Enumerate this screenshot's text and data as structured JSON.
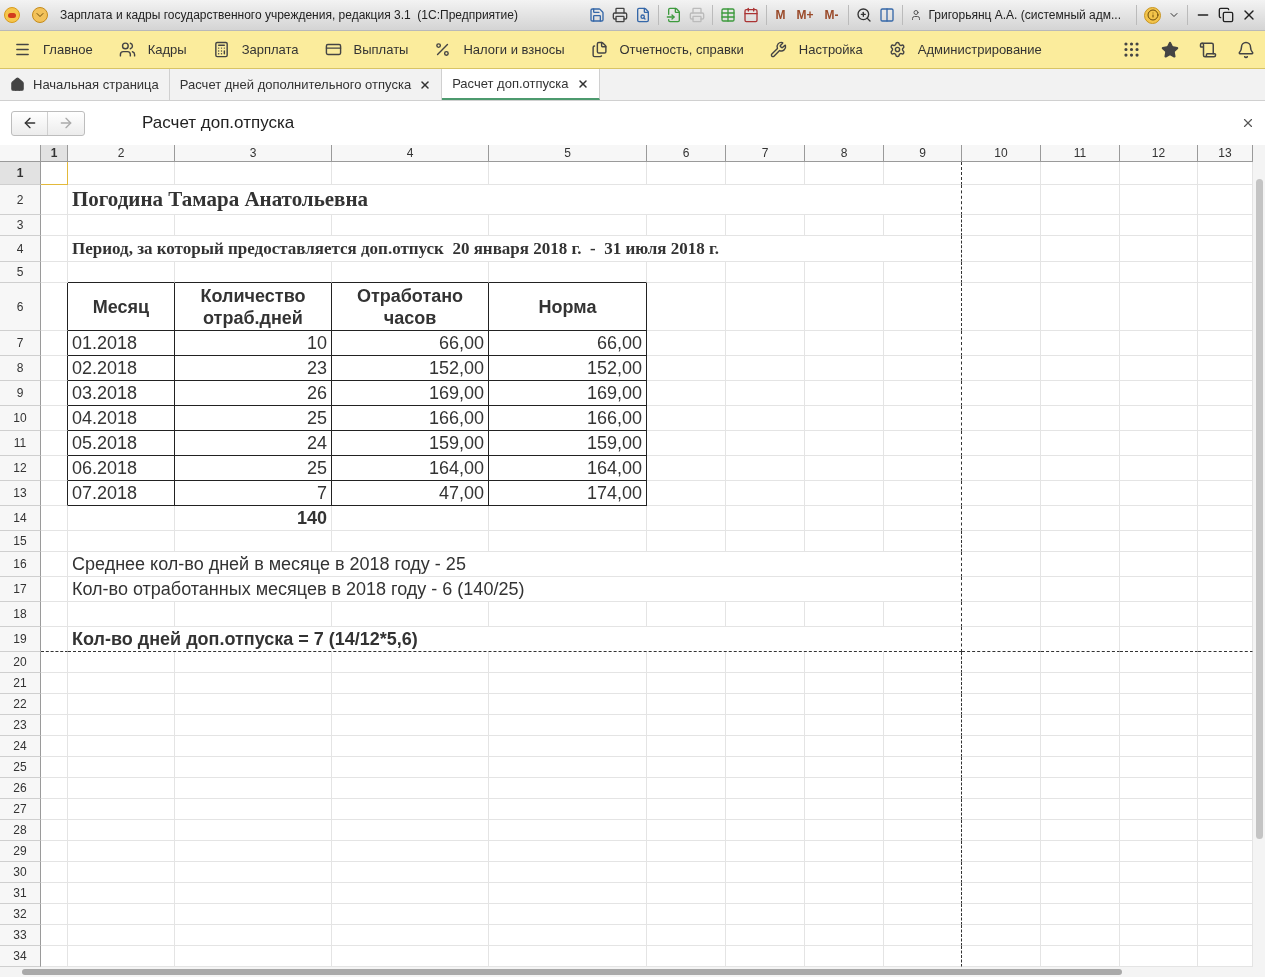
{
  "window": {
    "title": "Зарплата и кадры государственного учреждения, редакция 3.1  (1С:Предприятие)",
    "memory_buttons": [
      "M",
      "M+",
      "M-"
    ],
    "user": "Григорьянц А.А. (системный адм..."
  },
  "menu": [
    {
      "label": "Главное"
    },
    {
      "label": "Кадры"
    },
    {
      "label": "Зарплата"
    },
    {
      "label": "Выплаты"
    },
    {
      "label": "Налоги и взносы"
    },
    {
      "label": "Отчетность, справки"
    },
    {
      "label": "Настройка"
    },
    {
      "label": "Администрирование"
    }
  ],
  "tabs": [
    {
      "label": "Начальная страница",
      "selected": false,
      "kind": "home"
    },
    {
      "label": "Расчет дней дополнительного отпуска",
      "selected": false,
      "kind": "closable"
    },
    {
      "label": "Расчет доп.отпуска",
      "selected": true,
      "kind": "closable"
    }
  ],
  "form": {
    "title": "Расчет доп.отпуска"
  },
  "sheet": {
    "columns": [
      {
        "label": "1",
        "selected": true
      },
      {
        "label": "2",
        "selected": false
      },
      {
        "label": "3",
        "selected": false
      },
      {
        "label": "4",
        "selected": false
      },
      {
        "label": "5",
        "selected": false
      },
      {
        "label": "6",
        "selected": false
      },
      {
        "label": "7",
        "selected": false
      },
      {
        "label": "8",
        "selected": false
      },
      {
        "label": "9",
        "selected": false
      },
      {
        "label": "10",
        "selected": false
      },
      {
        "label": "11",
        "selected": false
      },
      {
        "label": "12",
        "selected": false
      },
      {
        "label": "13",
        "selected": false
      }
    ],
    "rows": [
      {
        "label": "1",
        "selected": true
      },
      {
        "label": "2",
        "selected": false
      },
      {
        "label": "3",
        "selected": false
      },
      {
        "label": "4",
        "selected": false
      },
      {
        "label": "5",
        "selected": false
      },
      {
        "label": "6",
        "selected": false
      },
      {
        "label": "7",
        "selected": false
      },
      {
        "label": "8",
        "selected": false
      },
      {
        "label": "9",
        "selected": false
      },
      {
        "label": "10",
        "selected": false
      },
      {
        "label": "11",
        "selected": false
      },
      {
        "label": "12",
        "selected": false
      },
      {
        "label": "13",
        "selected": false
      },
      {
        "label": "14",
        "selected": false
      },
      {
        "label": "15",
        "selected": false
      },
      {
        "label": "16",
        "selected": false
      },
      {
        "label": "17",
        "selected": false
      },
      {
        "label": "18",
        "selected": false
      },
      {
        "label": "19",
        "selected": false
      },
      {
        "label": "20",
        "selected": false
      },
      {
        "label": "21",
        "selected": false
      },
      {
        "label": "22",
        "selected": false
      },
      {
        "label": "23",
        "selected": false
      },
      {
        "label": "24",
        "selected": false
      },
      {
        "label": "25",
        "selected": false
      },
      {
        "label": "26",
        "selected": false
      },
      {
        "label": "27",
        "selected": false
      },
      {
        "label": "28",
        "selected": false
      },
      {
        "label": "29",
        "selected": false
      },
      {
        "label": "30",
        "selected": false
      },
      {
        "label": "31",
        "selected": false
      },
      {
        "label": "32",
        "selected": false
      },
      {
        "label": "33",
        "selected": false
      },
      {
        "label": "34",
        "selected": false
      }
    ]
  },
  "report": {
    "employee_name": "Погодина Тамара Анатольевна",
    "period": "Период, за который предоставляется доп.отпуск  20 января 2018 г.  -  31 июля 2018 г.",
    "table": {
      "columns": [
        "Месяц",
        "Количество отраб.дней",
        "Отработано часов",
        "Норма"
      ],
      "rows": [
        [
          "01.2018",
          "10",
          "66,00",
          "66,00"
        ],
        [
          "02.2018",
          "23",
          "152,00",
          "152,00"
        ],
        [
          "03.2018",
          "26",
          "169,00",
          "169,00"
        ],
        [
          "04.2018",
          "25",
          "166,00",
          "166,00"
        ],
        [
          "05.2018",
          "24",
          "159,00",
          "159,00"
        ],
        [
          "06.2018",
          "25",
          "164,00",
          "164,00"
        ],
        [
          "07.2018",
          "7",
          "47,00",
          "174,00"
        ]
      ],
      "total": "140"
    },
    "notes": [
      "Среднее кол-во дней в месяце в 2018 году - 25",
      "Кол-во отработанных месяцев в 2018 году - 6 (140/25)"
    ],
    "result": "Кол-во дней доп.отпуска = 7 (14/12*5,6)"
  }
}
